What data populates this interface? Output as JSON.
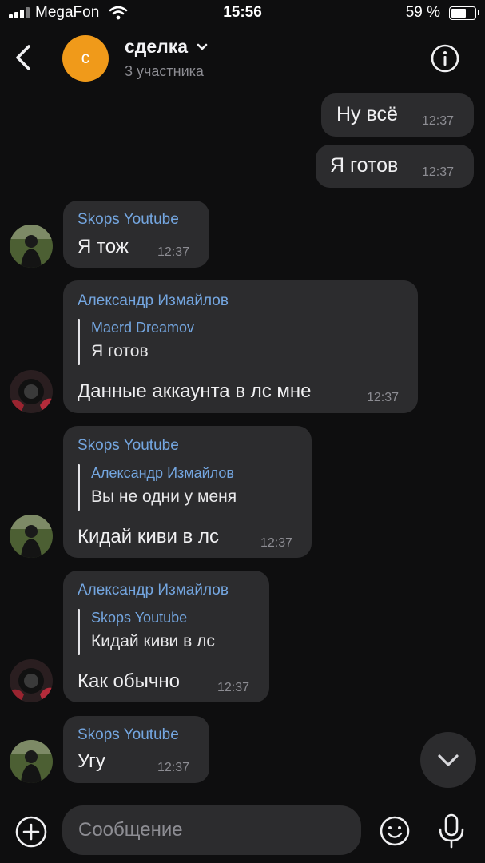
{
  "status_bar": {
    "carrier": "MegaFon",
    "time": "15:56",
    "battery": "59 %"
  },
  "header": {
    "avatar_letter": "с",
    "title": "сделка",
    "subtitle": "3 участника"
  },
  "messages": [
    {
      "type": "out",
      "text": "Ну всё",
      "time": "12:37"
    },
    {
      "type": "out",
      "text": "Я готов",
      "time": "12:37"
    },
    {
      "type": "in",
      "sender": "Skops Youtube",
      "text": "Я тож",
      "time": "12:37"
    },
    {
      "type": "in",
      "sender": "Александр Измайлов",
      "quote": {
        "author": "Maerd Dreamov",
        "text": "Я готов"
      },
      "text": "Данные аккаунта в лс мне",
      "time": "12:37"
    },
    {
      "type": "in",
      "sender": "Skops Youtube",
      "quote": {
        "author": "Александр Измайлов",
        "text": "Вы не одни у меня"
      },
      "text": "Кидай киви в лс",
      "time": "12:37"
    },
    {
      "type": "in",
      "sender": "Александр Измайлов",
      "quote": {
        "author": "Skops Youtube",
        "text": "Кидай киви в лс"
      },
      "text": "Как обычно",
      "time": "12:37"
    },
    {
      "type": "in",
      "sender": "Skops Youtube",
      "text": "Угу",
      "time": "12:37"
    }
  ],
  "input": {
    "placeholder": "Сообщение"
  },
  "colors": {
    "accent_orange": "#f09a1a",
    "sender_blue": "#74a6e0",
    "bubble": "#2c2c2e",
    "background": "#0e0e0f"
  },
  "icons": [
    "back-icon",
    "chevron-down-icon",
    "info-icon",
    "scroll-down-icon",
    "plus-icon",
    "emoji-icon",
    "mic-icon"
  ]
}
